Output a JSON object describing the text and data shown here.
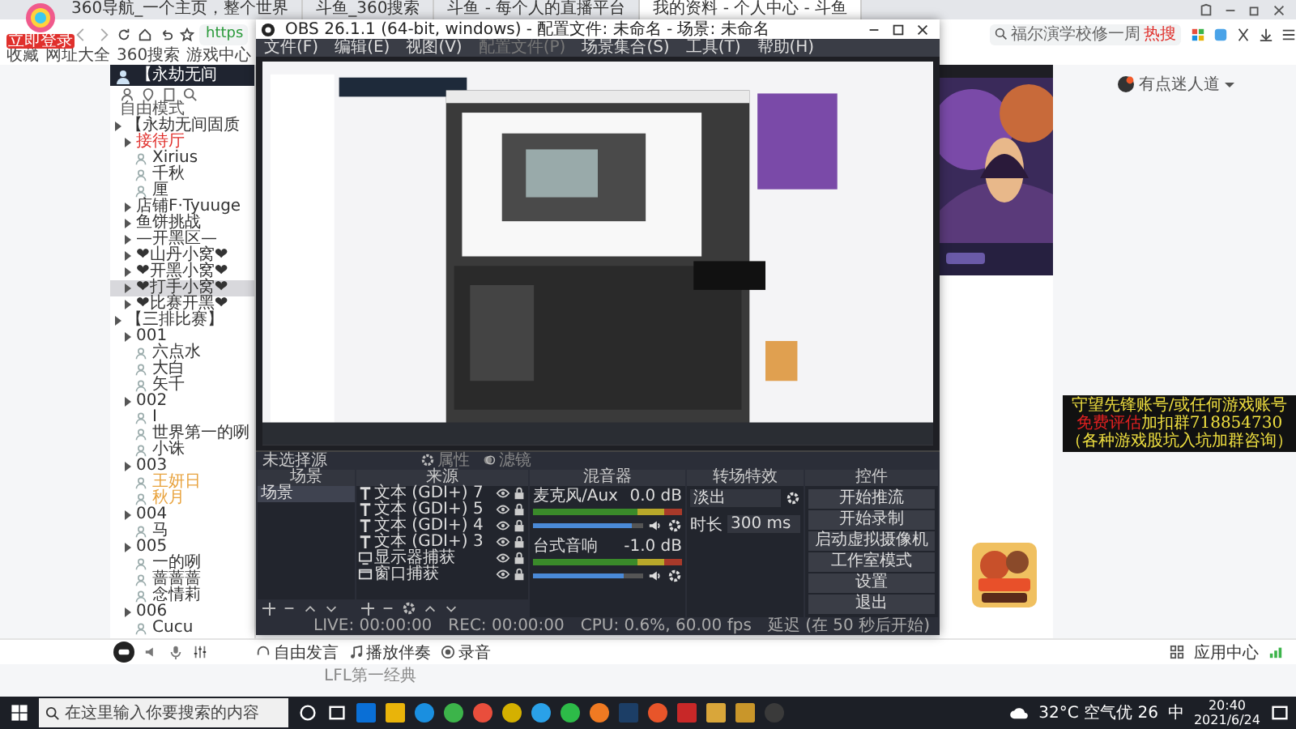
{
  "browser": {
    "tabs": [
      {
        "label": "360导航_一个主页，整个世界",
        "selected": false
      },
      {
        "label": "斗鱼_360搜索",
        "selected": false
      },
      {
        "label": "斗鱼 - 每个人的直播平台",
        "selected": false
      },
      {
        "label": "我的资料 - 个人中心 - 斗鱼",
        "selected": true
      }
    ],
    "login_badge": "立即登录",
    "address": "https",
    "search": {
      "placeholder": "福尔演学校修一周",
      "hot_badge": "热搜"
    },
    "bookmarks": [
      "收藏",
      "网址大全",
      "360搜索",
      "游戏中心"
    ]
  },
  "chat_panel": {
    "title": "【永劫无间",
    "mode": "自由模式",
    "tree": [
      {
        "label": "【永劫无间固质",
        "kind": "channel",
        "selected": false,
        "children": [
          {
            "label": "接待厅",
            "kind": "channel",
            "selected": false,
            "color": "#e0302c",
            "children": [
              {
                "label": "Xirius",
                "kind": "user",
                "selected": false
              },
              {
                "label": "千秋",
                "kind": "user",
                "selected": false
              },
              {
                "label": "厘",
                "kind": "user",
                "selected": false
              }
            ]
          },
          {
            "label": "店铺F·Tyuuge",
            "kind": "channel",
            "selected": false
          },
          {
            "label": "鱼饼挑战",
            "kind": "channel",
            "selected": false
          },
          {
            "label": "—开黑区—",
            "kind": "channel",
            "selected": false
          },
          {
            "label": "❤山丹小窝❤",
            "kind": "channel",
            "selected": false
          },
          {
            "label": "❤开黑小窝❤",
            "kind": "channel",
            "selected": false
          },
          {
            "label": "❤打手小窝❤",
            "kind": "channel",
            "selected": true
          },
          {
            "label": "❤比赛开黑❤",
            "kind": "channel",
            "selected": false
          }
        ]
      },
      {
        "label": "【三排比赛】",
        "kind": "channel",
        "selected": false,
        "children": [
          {
            "label": "001",
            "kind": "channel",
            "selected": false,
            "children": [
              {
                "label": "六点水",
                "kind": "user",
                "selected": false
              },
              {
                "label": "大白",
                "kind": "user",
                "selected": false
              },
              {
                "label": "矢千",
                "kind": "user",
                "selected": false
              }
            ]
          },
          {
            "label": "002",
            "kind": "channel",
            "selected": false,
            "children": [
              {
                "label": "I",
                "kind": "user",
                "selected": false
              },
              {
                "label": "世界第一的咧",
                "kind": "user",
                "selected": false
              },
              {
                "label": "小诛",
                "kind": "user",
                "selected": false
              }
            ]
          },
          {
            "label": "003",
            "kind": "channel",
            "selected": false,
            "children": [
              {
                "label": "王妍日",
                "kind": "user",
                "selected": false,
                "color": "#e8a23c"
              },
              {
                "label": "秋月",
                "kind": "user",
                "selected": false,
                "color": "#e8a23c"
              }
            ]
          },
          {
            "label": "004",
            "kind": "channel",
            "selected": false,
            "children": [
              {
                "label": "马",
                "kind": "user",
                "selected": false
              }
            ]
          },
          {
            "label": "005",
            "kind": "channel",
            "selected": false,
            "children": [
              {
                "label": "一的咧",
                "kind": "user",
                "selected": false
              },
              {
                "label": "蔷蔷蔷",
                "kind": "user",
                "selected": false
              },
              {
                "label": "念情莉",
                "kind": "user",
                "selected": false
              }
            ]
          },
          {
            "label": "006",
            "kind": "channel",
            "selected": false,
            "children": [
              {
                "label": "Cucu",
                "kind": "user",
                "selected": false
              }
            ]
          }
        ]
      }
    ]
  },
  "bottom_bar": {
    "actions": [
      "自由发言",
      "播放伴奏",
      "录音"
    ],
    "app_center": "应用中心"
  },
  "recommendation": "LFL第一经典",
  "user_menu": "有点迷人道",
  "ad_box": {
    "line_1": "守望先锋账号/或任何游戏账号",
    "line_2_highlight": "免费评估",
    "line_2": "加扣群718854730",
    "line_3": "（各种游戏股坑入坑加群咨询）"
  },
  "obs": {
    "title": "OBS 26.1.1 (64-bit, windows) - 配置文件: 未命名 - 场景: 未命名",
    "menu": [
      {
        "label": "文件(F)",
        "disabled": false
      },
      {
        "label": "编辑(E)",
        "disabled": false
      },
      {
        "label": "视图(V)",
        "disabled": false
      },
      {
        "label": "配置文件(P)",
        "disabled": true
      },
      {
        "label": "场景集合(S)",
        "disabled": false
      },
      {
        "label": "工具(T)",
        "disabled": false
      },
      {
        "label": "帮助(H)",
        "disabled": false
      }
    ],
    "source_bar": {
      "label": "未选择源",
      "buttons": [
        "属性",
        "滤镜"
      ]
    },
    "scenes": {
      "title": "场景",
      "items": [
        {
          "label": "场景",
          "selected": true
        }
      ]
    },
    "sources": {
      "title": "来源",
      "items": [
        {
          "label": "文本 (GDI+) 7",
          "kind": "text"
        },
        {
          "label": "文本 (GDI+) 5",
          "kind": "text"
        },
        {
          "label": "文本 (GDI+) 4",
          "kind": "text"
        },
        {
          "label": "文本 (GDI+) 3",
          "kind": "text"
        },
        {
          "label": "显示器捕获",
          "kind": "display"
        },
        {
          "label": "窗口捕获",
          "kind": "window"
        }
      ]
    },
    "mixer": {
      "title": "混音器",
      "channels": [
        {
          "name": "麦克风/Aux",
          "reading": "0.0 dB",
          "level": 0.9
        },
        {
          "name": "台式音响",
          "reading": "-1.0 dB",
          "level": 0.82
        }
      ]
    },
    "transitions": {
      "title": "转场特效",
      "selected": "淡出",
      "duration_label": "时长",
      "duration": "300 ms"
    },
    "controls": {
      "title": "控件",
      "buttons": [
        "开始推流",
        "开始录制",
        "启动虚拟摄像机",
        "工作室模式",
        "设置",
        "退出"
      ]
    },
    "status": {
      "live": "LIVE: 00:00:00",
      "rec": "REC: 00:00:00",
      "cpu": "CPU: 0.6%, 60.00 fps",
      "delay": "延迟 (在 50 秒后开始)"
    }
  },
  "taskbar": {
    "search_placeholder": "在这里输入你要搜索的内容",
    "weather": "32°C 空气优 26",
    "input_method": "中",
    "time": "20:40",
    "date": "2021/6/24"
  }
}
